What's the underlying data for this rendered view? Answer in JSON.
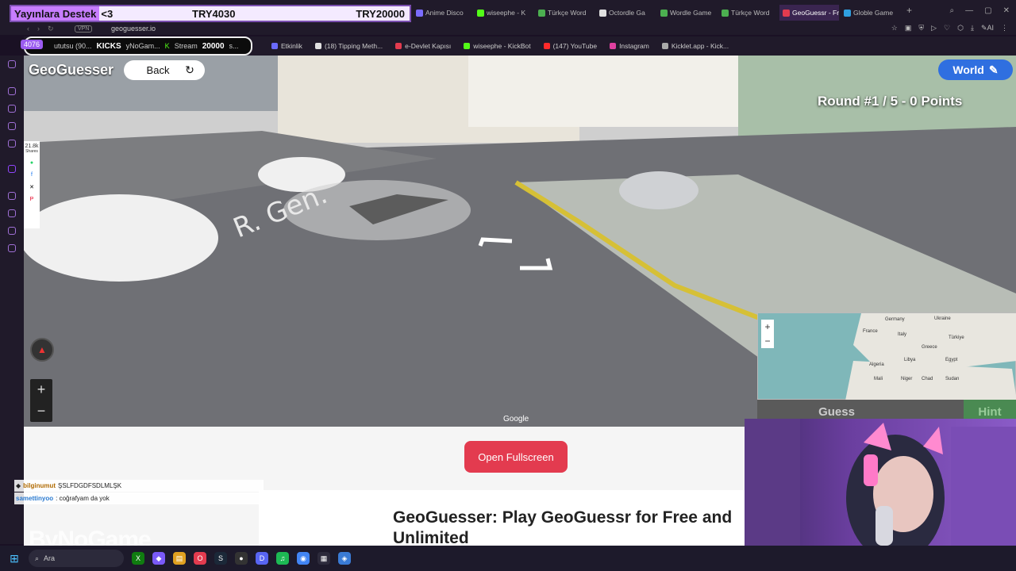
{
  "donation": {
    "label": "Yayınlara Destek",
    "message": "<3",
    "amount1": "TRY4030",
    "amount2": "TRY20000"
  },
  "tabs": [
    {
      "label": "Anime Disco",
      "color": "#7b6cff",
      "active": false
    },
    {
      "label": "wiseephe - K",
      "color": "#53fc18",
      "active": false
    },
    {
      "label": "Türkçe Word",
      "color": "#4caf50",
      "active": false
    },
    {
      "label": "Octordle Ga",
      "color": "#e0e0e0",
      "active": false
    },
    {
      "label": "Wordle Game",
      "color": "#4caf50",
      "active": false
    },
    {
      "label": "Türkçe Word",
      "color": "#4caf50",
      "active": false
    },
    {
      "label": "GeoGuessr - Free Ge",
      "color": "#e33b4f",
      "active": true
    },
    {
      "label": "Globle Game",
      "color": "#2fa0e0",
      "active": false
    }
  ],
  "address": {
    "vpn": "VPN",
    "url": "geoguesser.io"
  },
  "bookmarks": {
    "counter": "4076",
    "kicks_prefix": "ututsu (90...",
    "kicks_label": "KICKS",
    "kicks_sub": "yNoGam...",
    "stream_label": "Stream",
    "stream_value": "20000",
    "stream_suffix": "s...",
    "items": [
      {
        "label": "Etkinlik",
        "color": "#6b6bff"
      },
      {
        "label": "(18) Tipping Meth...",
        "color": "#e0e0e0"
      },
      {
        "label": "e-Devlet Kapısı",
        "color": "#e33b4f"
      },
      {
        "label": "wiseephe - KickBot",
        "color": "#53fc18"
      },
      {
        "label": "(147) YouTube",
        "color": "#ff2a2a"
      },
      {
        "label": "Instagram",
        "color": "#e040a0"
      },
      {
        "label": "Kicklet.app - Kick...",
        "color": "#aaaaaa"
      }
    ]
  },
  "share": {
    "count": "21.8k",
    "count_label": "Shares"
  },
  "game": {
    "brand": "GeoGuesser",
    "back": "Back",
    "refresh_icon": "↻",
    "world": "World",
    "round_text": "Round #1 / 5 - 0 Points",
    "google": "Google",
    "guess": "Guess",
    "hint": "Hint",
    "minimap_labels": [
      "Germany",
      "Ukraine",
      "France",
      "Italy",
      "Türkiye",
      "Greece",
      "Libya",
      "Egypt",
      "Algeria",
      "Mali",
      "Niger",
      "Sudan",
      "Chad"
    ]
  },
  "page": {
    "fullscreen": "Open Fullscreen",
    "title": "GeoGuesser: Play GeoGuessr for Free and Unlimited"
  },
  "chat": [
    {
      "user": "bilginumut",
      "text": "ŞSLFDGDFSDLMLŞK"
    },
    {
      "user": "samettinyoo",
      "text": ": coğrafyam da yok"
    }
  ],
  "watermark": "ByNoGame",
  "taskbar": {
    "search": "Ara"
  }
}
